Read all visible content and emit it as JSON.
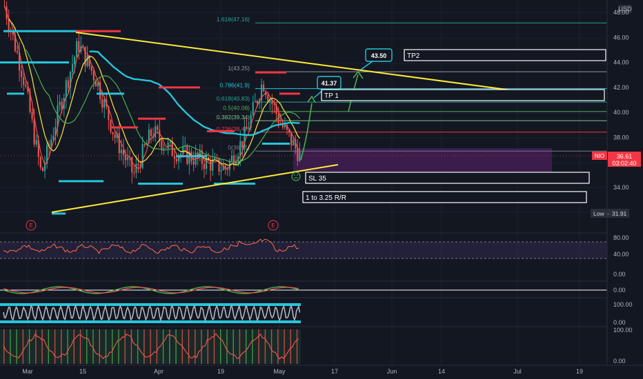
{
  "currency": "USD",
  "price_axis_labels": [
    "48.00",
    "46.00",
    "44.00",
    "42.00",
    "40.00",
    "38.00",
    "36.00",
    "34.00"
  ],
  "date_labels": [
    "Mar",
    "15",
    "Apr",
    "19",
    "May",
    "17",
    "Jun",
    "14",
    "Jul",
    "19"
  ],
  "symbol": "NIO",
  "last_price": "36.61",
  "countdown": "03:02:40",
  "low_label": "Low",
  "low_value": "31.91",
  "earnings_marker": "E",
  "annotations": {
    "tp1": "TP 1",
    "tp2": "TP2",
    "sl": "SL 35",
    "rr": "1 to 3.25 R/R",
    "target1_price": "41.37",
    "target2_price": "43.50"
  },
  "fib_levels": [
    {
      "label": "1.618(47.16)",
      "color": "#26a69a"
    },
    {
      "label": "1(43.25)",
      "color": "#9598a1"
    },
    {
      "label": "0.786(41.9)",
      "color": "#26c6da"
    },
    {
      "label": "0.618(40.83)",
      "color": "#26a69a"
    },
    {
      "label": "0.5(40.08)",
      "color": "#4caf50"
    },
    {
      "label": "0.382(39.34)",
      "color": "#81c784"
    },
    {
      "label": "0.236(38.42)",
      "color": "#f23645"
    },
    {
      "label": "0(36.91)",
      "color": "#787b86"
    }
  ],
  "rsi_axis": [
    "80.00",
    "40.00",
    "0.00"
  ],
  "macd_axis": [
    "0.00"
  ],
  "stoch_axis": [
    "100.00",
    "0.00"
  ],
  "osc_axis": [
    "100.00",
    "0.00"
  ],
  "colors": {
    "background": "#131722",
    "up": "#26a69a",
    "down": "#ef5350",
    "trendline": "#ffeb3b",
    "accent_cyan": "#26c6da",
    "price_tag": "#f23645",
    "rsi_band": "#7e57c2",
    "sl_zone": "#4a1f5a"
  },
  "chart_data": {
    "type": "line",
    "title": "",
    "ylabel": "USD",
    "ylim": [
      31.0,
      49.0
    ],
    "series": [
      {
        "name": "NIO",
        "x": [
          "Feb 25",
          "Mar 1",
          "Mar 5",
          "Mar 10",
          "Mar 15",
          "Mar 19",
          "Mar 24",
          "Mar 29",
          "Apr 1",
          "Apr 6",
          "Apr 9",
          "Apr 14",
          "Apr 19",
          "Apr 23",
          "Apr 28",
          "May 3",
          "May 7"
        ],
        "values": [
          48.5,
          43.0,
          35.0,
          40.5,
          45.5,
          42.5,
          38.0,
          35.0,
          38.5,
          37.0,
          36.5,
          36.0,
          35.5,
          38.0,
          42.5,
          39.0,
          36.61
        ]
      }
    ]
  }
}
